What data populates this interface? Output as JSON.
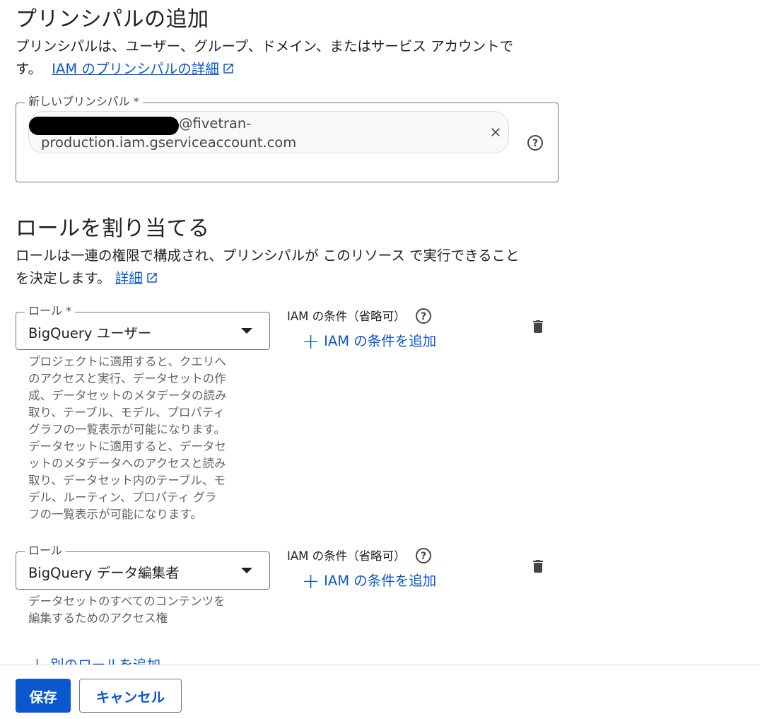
{
  "principal_section": {
    "title": "プリンシパルの追加",
    "description_line1": "プリンシパルは、ユーザー、グループ、ドメイン、またはサービス アカウントで",
    "description_line2": "す。",
    "link_text": "IAM のプリンシパルの詳細",
    "field_label": "新しいプリンシパル *",
    "chip_text_line1": "@fivetran-",
    "chip_text_line2": "production.iam.gserviceaccount.com"
  },
  "roles_section": {
    "title": "ロールを割り当てる",
    "description_line1": "ロールは一連の権限で構成され、プリンシパルが このリソース で実行できること",
    "description_line2": "を決定します。",
    "link_text": "詳細"
  },
  "role_rows": [
    {
      "label": "ロール *",
      "value": "BigQuery ユーザー",
      "condition_label": "IAM の条件（省略可）",
      "add_condition": "IAM の条件を追加",
      "description": [
        "プロジェクトに適用すると、クエリへ",
        "のアクセスと実行、データセットの作",
        "成、データセットのメタデータの読み",
        "取り、テーブル、モデル、プロパティ",
        "グラフの一覧表示が可能になります。",
        "データセットに適用すると、データセ",
        "ットのメタデータへのアクセスと読み",
        "取り、データセット内のテーブル、モ",
        "デル、ルーティン、プロパティ グラ",
        "フの一覧表示が可能になります。"
      ]
    },
    {
      "label": "ロール",
      "value": "BigQuery データ編集者",
      "condition_label": "IAM の条件（省略可）",
      "add_condition": "IAM の条件を追加",
      "description": [
        "データセットのすべてのコンテンツを",
        "編集するためのアクセス権"
      ]
    }
  ],
  "add_role_label": "別のロールを追加",
  "footer": {
    "save": "保存",
    "cancel": "キャンセル"
  },
  "icons": {
    "external_link": "external-link-icon",
    "clear": "close-icon",
    "help": "help-icon",
    "delete": "trash-icon",
    "dropdown": "dropdown-arrow-icon",
    "add": "plus-icon"
  },
  "colors": {
    "accent": "#0b57d0",
    "text": "#202124",
    "muted": "#5f6368"
  }
}
